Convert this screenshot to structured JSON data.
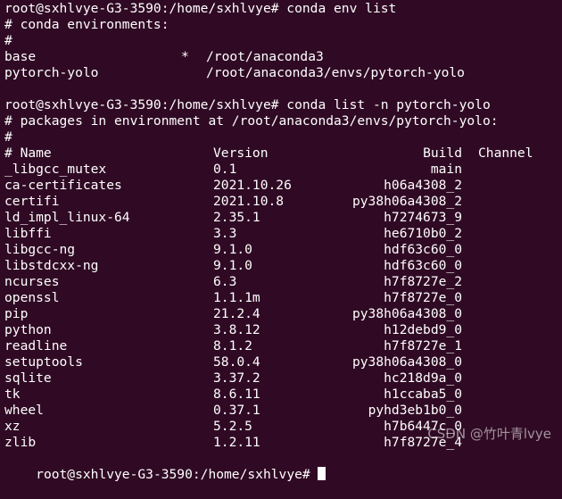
{
  "terminal": {
    "bg_color": "#300a24",
    "fg_color": "#ffffff",
    "cmd1": "root@sxhlvye-G3-3590:/home/sxhlvye# conda env list",
    "env_header": "# conda environments:",
    "hash": "#",
    "envs": [
      {
        "name": "base",
        "star": "*",
        "path": "/root/anaconda3"
      },
      {
        "name": "pytorch-yolo",
        "star": "",
        "path": "/root/anaconda3/envs/pytorch-yolo"
      }
    ],
    "cmd2": "root@sxhlvye-G3-3590:/home/sxhlvye# conda list -n pytorch-yolo",
    "pkg_header": "# packages in environment at /root/anaconda3/envs/pytorch-yolo:",
    "columns": {
      "name": "# Name",
      "version": "Version",
      "build": "Build",
      "channel": "Channel"
    },
    "packages": [
      {
        "name": "_libgcc_mutex",
        "version": "0.1",
        "build": "main",
        "channel": ""
      },
      {
        "name": "ca-certificates",
        "version": "2021.10.26",
        "build": "h06a4308_2",
        "channel": ""
      },
      {
        "name": "certifi",
        "version": "2021.10.8",
        "build": "py38h06a4308_2",
        "channel": ""
      },
      {
        "name": "ld_impl_linux-64",
        "version": "2.35.1",
        "build": "h7274673_9",
        "channel": ""
      },
      {
        "name": "libffi",
        "version": "3.3",
        "build": "he6710b0_2",
        "channel": ""
      },
      {
        "name": "libgcc-ng",
        "version": "9.1.0",
        "build": "hdf63c60_0",
        "channel": ""
      },
      {
        "name": "libstdcxx-ng",
        "version": "9.1.0",
        "build": "hdf63c60_0",
        "channel": ""
      },
      {
        "name": "ncurses",
        "version": "6.3",
        "build": "h7f8727e_2",
        "channel": ""
      },
      {
        "name": "openssl",
        "version": "1.1.1m",
        "build": "h7f8727e_0",
        "channel": ""
      },
      {
        "name": "pip",
        "version": "21.2.4",
        "build": "py38h06a4308_0",
        "channel": ""
      },
      {
        "name": "python",
        "version": "3.8.12",
        "build": "h12debd9_0",
        "channel": ""
      },
      {
        "name": "readline",
        "version": "8.1.2",
        "build": "h7f8727e_1",
        "channel": ""
      },
      {
        "name": "setuptools",
        "version": "58.0.4",
        "build": "py38h06a4308_0",
        "channel": ""
      },
      {
        "name": "sqlite",
        "version": "3.37.2",
        "build": "hc218d9a_0",
        "channel": ""
      },
      {
        "name": "tk",
        "version": "8.6.11",
        "build": "h1ccaba5_0",
        "channel": ""
      },
      {
        "name": "wheel",
        "version": "0.37.1",
        "build": "pyhd3eb1b0_0",
        "channel": ""
      },
      {
        "name": "xz",
        "version": "5.2.5",
        "build": "h7b6447c_0",
        "channel": ""
      },
      {
        "name": "zlib",
        "version": "1.2.11",
        "build": "h7f8727e_4",
        "channel": ""
      }
    ],
    "prompt": "root@sxhlvye-G3-3590:/home/sxhlvye#"
  },
  "watermark": "CSDN @竹叶青lvye"
}
